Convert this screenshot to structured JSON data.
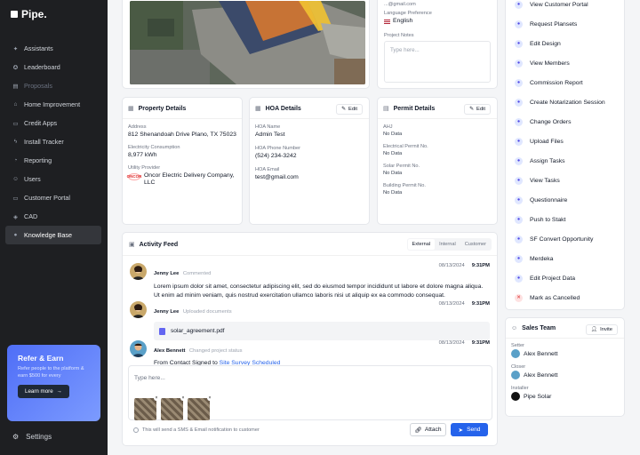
{
  "brand": {
    "name": "Pipe."
  },
  "nav": [
    {
      "label": "Assistants",
      "icon": "sparkle-icon"
    },
    {
      "label": "Leaderboard",
      "icon": "trophy-icon"
    },
    {
      "label": "Proposals",
      "icon": "document-icon",
      "dim": true
    },
    {
      "label": "Home Improvement",
      "icon": "home-icon"
    },
    {
      "label": "Credit Apps",
      "icon": "card-icon"
    },
    {
      "label": "Install Tracker",
      "icon": "bolt-icon"
    },
    {
      "label": "Reporting",
      "icon": "chart-icon"
    },
    {
      "label": "Users",
      "icon": "users-icon"
    },
    {
      "label": "Customer Portal",
      "icon": "monitor-icon"
    },
    {
      "label": "CAD",
      "icon": "cube-icon"
    },
    {
      "label": "Knowledge Base",
      "icon": "pin-icon",
      "active": true
    }
  ],
  "refer": {
    "title": "Refer & Earn",
    "text": "Refer people to the platform & earn $500 for every",
    "button": "Learn more"
  },
  "settings": {
    "label": "Settings"
  },
  "project": {
    "language_label": "Language Preference",
    "language_value": "English",
    "email_partial": "...@gmail.com",
    "notes_label": "Project Notes",
    "notes_placeholder": "Type here..."
  },
  "property": {
    "title": "Property Details",
    "address_label": "Address",
    "address_value": "812 Shenandoah Drive Plano, TX 75023",
    "consumption_label": "Electricity Consumption",
    "consumption_value": "8,977 kWh",
    "utility_label": "Utility Provider",
    "utility_value": "Oncor Electric Delivery Company, LLC",
    "utility_logo": "ONCOR"
  },
  "hoa": {
    "title": "HOA Details",
    "edit": "Edit",
    "name_label": "HOA Name",
    "name_value": "Admin Test",
    "phone_label": "HOA Phone Number",
    "phone_value": "(524) 234-3242",
    "email_label": "HOA Email",
    "email_value": "test@gmail.com"
  },
  "permit": {
    "title": "Permit Details",
    "edit": "Edit",
    "ahj_label": "AHJ",
    "elec_label": "Electrical Permit No.",
    "solar_label": "Solar Permit No.",
    "building_label": "Building Permit No.",
    "no_data": "No Data"
  },
  "actions": [
    {
      "label": "View Customer Portal"
    },
    {
      "label": "Request Plansets"
    },
    {
      "label": "Edit Design"
    },
    {
      "label": "View Members"
    },
    {
      "label": "Commission Report"
    },
    {
      "label": "Create Notarization Session"
    },
    {
      "label": "Change Orders"
    },
    {
      "label": "Upload Files"
    },
    {
      "label": "Assign Tasks"
    },
    {
      "label": "View Tasks"
    },
    {
      "label": "Questionnaire"
    },
    {
      "label": "Push to Stakt"
    },
    {
      "label": "SF Convert Opportunity"
    },
    {
      "label": "Merdeka"
    },
    {
      "label": "Edit Project Data"
    },
    {
      "label": "Mark as Cancelled",
      "red": true
    }
  ],
  "feed": {
    "title": "Activity Feed",
    "tabs": [
      "External",
      "Internal",
      "Customer"
    ],
    "items": [
      {
        "name": "Jenny Lee",
        "action": "Commented",
        "date": "08/13/2024",
        "time": "9:31PM",
        "text": "Lorem ipsum dolor sit amet, consectetur adipiscing elit, sed do eiusmod tempor incididunt ut labore et dolore magna aliqua. Ut enim ad minim veniam, quis nostrud exercitation ullamco laboris nisi ut aliquip ex ea commodo consequat."
      },
      {
        "name": "Jenny Lee",
        "action": "Uploaded documents",
        "date": "08/13/2024",
        "time": "9:31PM",
        "file": "solar_agreement.pdf"
      },
      {
        "name": "Alex Bennett",
        "action": "Changed project status",
        "date": "08/13/2024",
        "time": "9:31PM",
        "prefix": "From Contact Signed to",
        "status": "Site Survey Scheduled"
      }
    ],
    "compose_placeholder": "Type here...",
    "notice": "This will send a SMS & Email notification to customer",
    "attach": "Attach",
    "send": "Send"
  },
  "sales": {
    "title": "Sales Team",
    "invite": "Invite",
    "setter_label": "Setter",
    "setter": "Alex Bennett",
    "closer_label": "Closer",
    "closer": "Alex Bennett",
    "installer_label": "Installer",
    "installer": "Pipe Solar"
  }
}
